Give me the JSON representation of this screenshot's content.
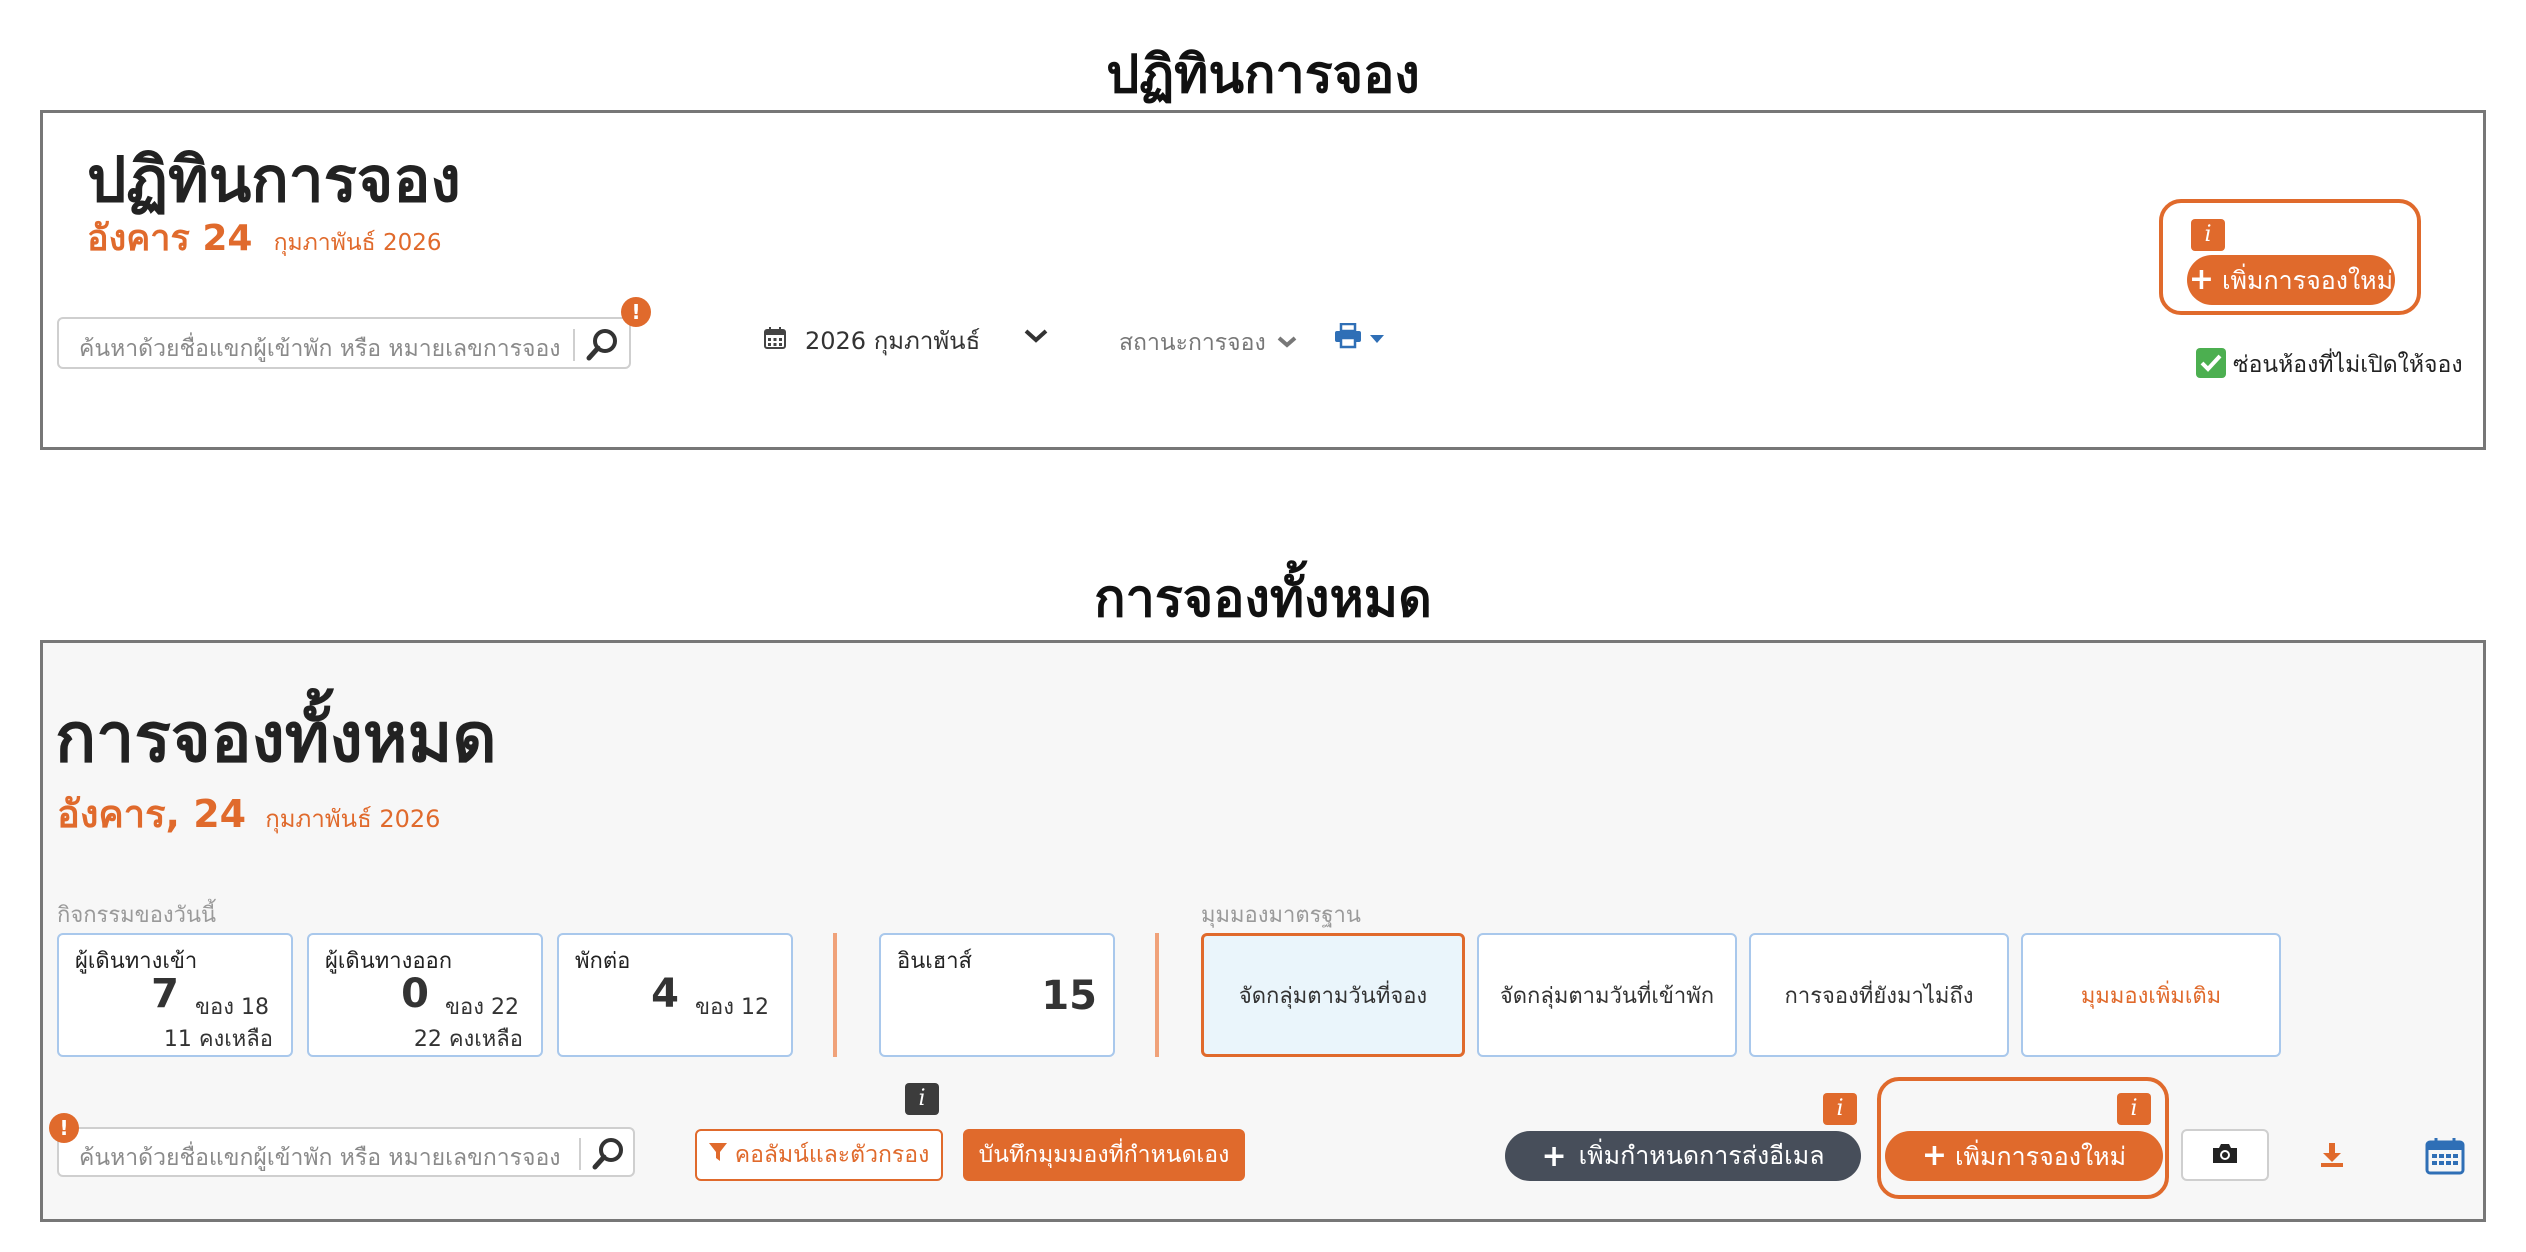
{
  "calendar_section": {
    "heading": "ปฏิทินการจอง",
    "title": "ปฏิทินการจอง",
    "date": {
      "day": "อังคาร 24",
      "month": "กุมภาพันธ์ 2026"
    },
    "search": {
      "placeholder": "ค้นหาด้วยชื่อแขกผู้เข้าพัก หรือ หมายเลขการจอง",
      "alert": "!"
    },
    "month_picker": {
      "icon": "calendar-icon",
      "value": "2026 กุมภาพันธ์"
    },
    "status_filter": "สถานะการจอง",
    "print_icon": "print-icon",
    "info_badge": "i",
    "add_booking_label": "เพิ่มการจองใหม่",
    "hide_rooms": {
      "label": "ซ่อนห้องที่ไม่เปิดให้จอง",
      "checked": true
    }
  },
  "all_bookings_section": {
    "heading": "การจองทั้งหมด",
    "title": "การจองทั้งหมด",
    "date": {
      "day": "อังคาร, 24",
      "month": "กุมภาพันธ์ 2026"
    },
    "today_label": "กิจกรรมของวันนี้",
    "stats": [
      {
        "label": "ผู้เดินทางเข้า",
        "value": "7",
        "of": "ของ 18",
        "remaining": "11 คงเหลือ"
      },
      {
        "label": "ผู้เดินทางออก",
        "value": "0",
        "of": "ของ 22",
        "remaining": "22 คงเหลือ"
      },
      {
        "label": "พักต่อ",
        "value": "4",
        "of": "ของ 12"
      }
    ],
    "inhouse": {
      "label": "อินเฮาส์",
      "value": "15"
    },
    "views_label": "มุมมองมาตรฐาน",
    "views": [
      {
        "label": "จัดกลุ่มตามวันที่จอง",
        "active": true
      },
      {
        "label": "จัดกลุ่มตามวันที่เข้าพัก"
      },
      {
        "label": "การจองที่ยังมาไม่ถึง"
      },
      {
        "label": "มุมมองเพิ่มเติม"
      }
    ],
    "search": {
      "placeholder": "ค้นหาด้วยชื่อแขกผู้เข้าพัก หรือ หมายเลขการจอง",
      "alert": "!"
    },
    "columns_filter_label": "คอลัมน์และตัวกรอง",
    "save_view_label": "บันทึกมุมมองที่กำหนดเอง",
    "add_email_schedule_label": "เพิ่มกำหนดการส่งอีเมล",
    "add_booking_label": "เพิ่มการจองใหม่",
    "info_badge": "i",
    "toolbar_icons": [
      "camera-icon",
      "download-icon",
      "calendar-icon"
    ],
    "colors": {
      "accent": "#e06a2c",
      "dark_button": "#474e5a",
      "card_border": "#a9c8ec"
    }
  }
}
